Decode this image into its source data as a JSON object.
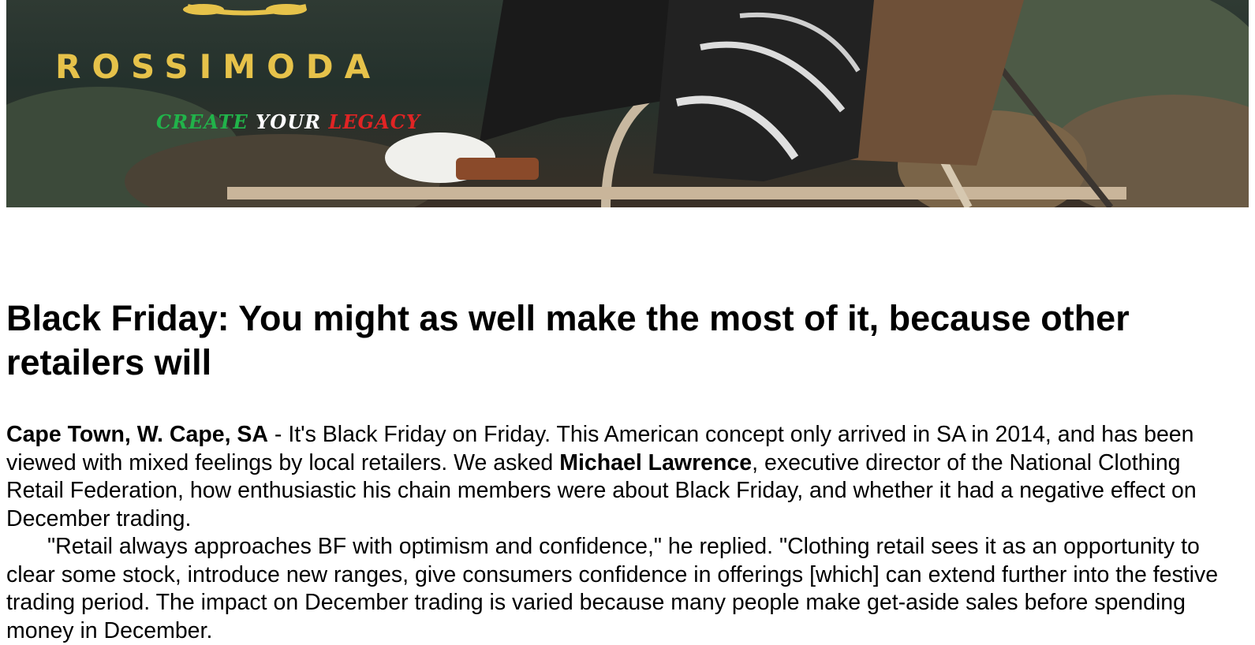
{
  "banner": {
    "brand": "ROSSIMODA",
    "tagline": {
      "part1": "CREATE",
      "part2": "YOUR",
      "part3": "LEGACY"
    },
    "colors": {
      "gold": "#e6c24a",
      "green": "#21b34a",
      "red": "#e02424"
    }
  },
  "article": {
    "title": "Black Friday: You might as well make the most of it, because other retailers will",
    "dateline": "Cape Town, W. Cape, SA",
    "p1_a": " - It's Black Friday on Friday. This American concept only arrived in SA in 2014, and has been viewed with mixed feelings by local retailers. We asked ",
    "p1_name": "Michael Lawrence",
    "p1_b": ", executive director of the National Clothing Retail Federation, how enthusiastic his chain members were about Black Friday, and whether it had a negative effect on December trading.",
    "p2": "\"Retail always approaches BF with optimism and confidence,\" he replied. \"Clothing retail sees it as an opportunity to clear some stock, introduce new ranges, give consumers confidence in offerings [which] can extend further into the festive trading period. The impact on December trading is varied because many people make get-aside sales before spending money in December."
  }
}
